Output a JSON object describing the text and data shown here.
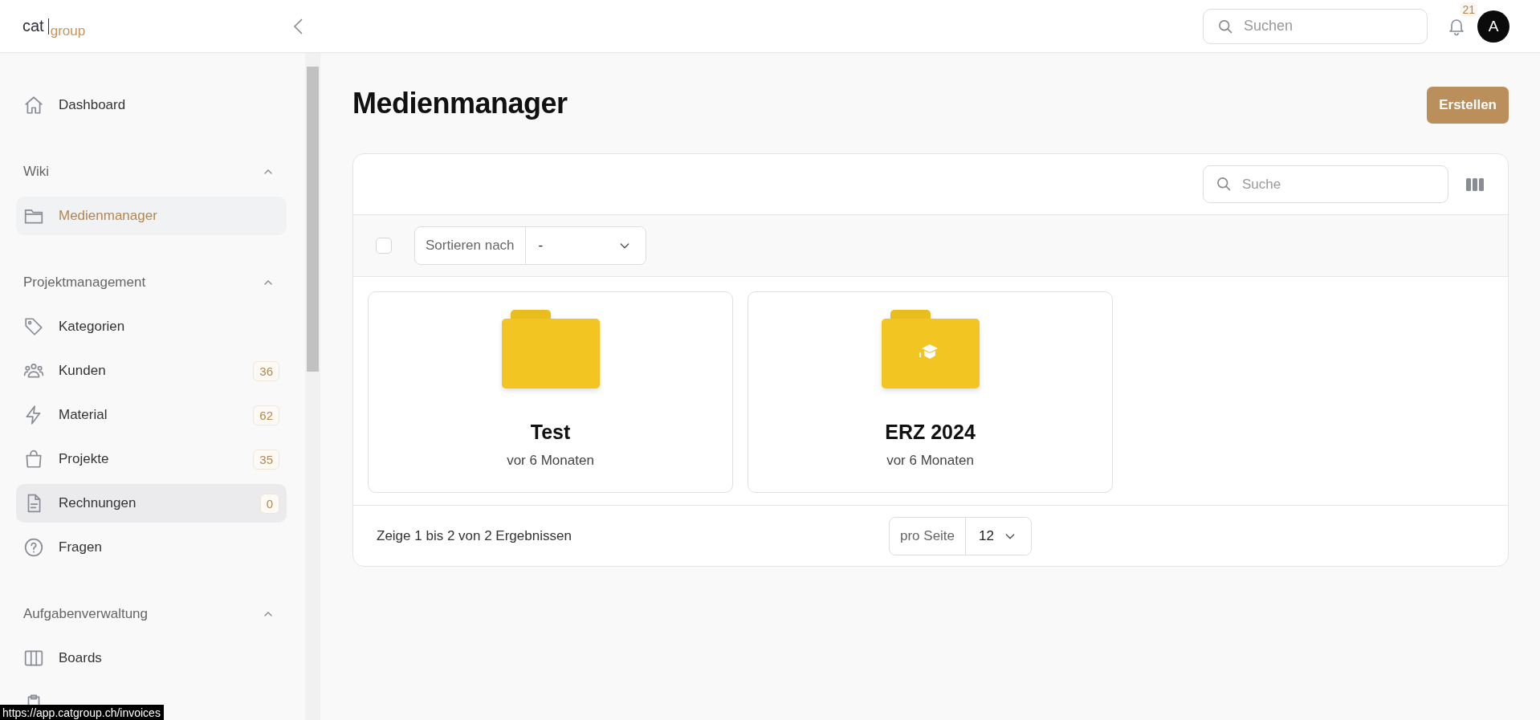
{
  "header": {
    "logo": {
      "primary": "cat",
      "secondary": "group"
    },
    "search": {
      "placeholder": "Suchen"
    },
    "notifications": {
      "count": "21"
    },
    "avatar": {
      "initial": "A"
    }
  },
  "sidebar": {
    "entries": [
      {
        "kind": "link",
        "label": "Dashboard",
        "selected": false,
        "hovered": false
      },
      {
        "kind": "group",
        "label": "Wiki",
        "expanded": true,
        "items": [
          {
            "label": "Medienmanager",
            "selected": true,
            "hovered": false
          }
        ]
      },
      {
        "kind": "group",
        "label": "Projektmanagement",
        "expanded": true,
        "items": [
          {
            "label": "Kategorien",
            "selected": false,
            "hovered": false
          },
          {
            "label": "Kunden",
            "count": "36",
            "selected": false,
            "hovered": false
          },
          {
            "label": "Material",
            "count": "62",
            "selected": false,
            "hovered": false
          },
          {
            "label": "Projekte",
            "count": "35",
            "selected": false,
            "hovered": false
          },
          {
            "label": "Rechnungen",
            "count": "0",
            "selected": false,
            "hovered": true
          },
          {
            "label": "Fragen",
            "selected": false,
            "hovered": false
          }
        ]
      },
      {
        "kind": "group",
        "label": "Aufgabenverwaltung",
        "expanded": true,
        "items": [
          {
            "label": "Boards",
            "selected": false,
            "hovered": false
          },
          {
            "kind": "covered"
          }
        ]
      }
    ],
    "status_tooltip": "https://app.catgroup.ch/invoices"
  },
  "page": {
    "title": "Medienmanager",
    "create_button": "Erstellen"
  },
  "media": {
    "search": {
      "placeholder": "Suche"
    },
    "select_all": {
      "checked": false
    },
    "sort": {
      "label": "Sortieren nach",
      "value": "-"
    },
    "folders": [
      {
        "kind": "plain",
        "name": "Test",
        "time": "vor 6 Monaten"
      },
      {
        "kind": "emblem",
        "name": "ERZ 2024",
        "time": "vor 6 Monaten"
      }
    ],
    "summary": "Zeige 1 bis 2 von 2 Ergebnissen",
    "per_page": {
      "label": "pro Seite",
      "value": "12"
    }
  }
}
